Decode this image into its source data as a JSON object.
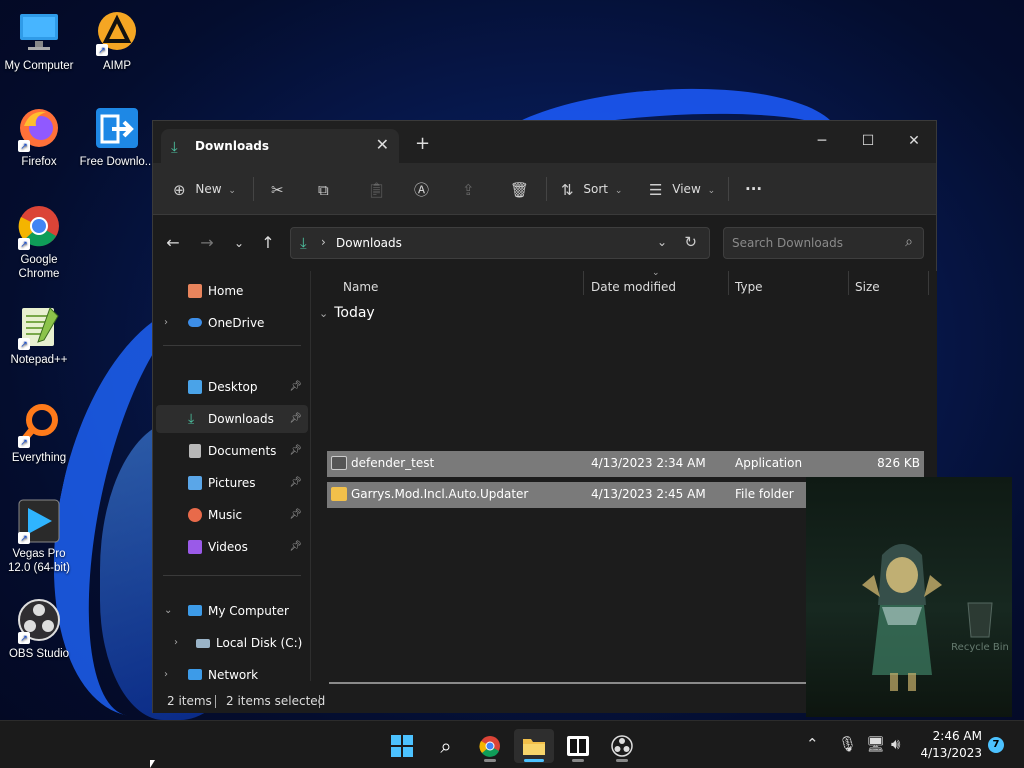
{
  "desktop": {
    "icons": [
      {
        "label": "My Computer",
        "icon": "computer-icon"
      },
      {
        "label": "AIMP",
        "icon": "aimp-icon"
      },
      {
        "label": "Firefox",
        "icon": "firefox-icon"
      },
      {
        "label": "Free Downlo...",
        "icon": "download-manager-icon"
      },
      {
        "label": "Google Chrome",
        "icon": "chrome-icon"
      },
      {
        "label": "Notepad++",
        "icon": "notepad-plus-plus-icon"
      },
      {
        "label": "Everything",
        "icon": "everything-search-icon"
      },
      {
        "label": "Vegas Pro 12.0 (64-bit)",
        "icon": "vegas-pro-icon"
      },
      {
        "label": "OBS Studio",
        "icon": "obs-studio-icon"
      }
    ]
  },
  "explorer": {
    "tab_title": "Downloads",
    "new_tab": "+",
    "window_controls": {
      "minimize": "─",
      "maximize": "☐",
      "close": "✕"
    },
    "toolbar": {
      "new_label": "New",
      "sort_label": "Sort",
      "view_label": "View",
      "more_label": "···"
    },
    "address": {
      "path": "Downloads",
      "search_placeholder": "Search Downloads"
    },
    "sidebar": {
      "items": [
        {
          "label": "Home",
          "icon": "home-icon",
          "color": "#e8845c"
        },
        {
          "label": "OneDrive",
          "icon": "onedrive-icon",
          "color": "#3d8ee8"
        },
        {
          "label": "Desktop",
          "icon": "desktop-folder-icon",
          "color": "#4aa3e8"
        },
        {
          "label": "Downloads",
          "icon": "downloads-folder-icon",
          "color": "#4cc2a0"
        },
        {
          "label": "Documents",
          "icon": "documents-folder-icon",
          "color": "#b8b8b8"
        },
        {
          "label": "Pictures",
          "icon": "pictures-folder-icon",
          "color": "#5aa6e8"
        },
        {
          "label": "Music",
          "icon": "music-folder-icon",
          "color": "#e86a4a"
        },
        {
          "label": "Videos",
          "icon": "videos-folder-icon",
          "color": "#9a5ae8"
        },
        {
          "label": "My Computer",
          "icon": "computer-icon",
          "color": "#3d9be8"
        },
        {
          "label": "Local Disk (C:)",
          "icon": "drive-icon",
          "color": "#9ab4c8"
        },
        {
          "label": "Network",
          "icon": "network-icon",
          "color": "#3d9be8"
        }
      ]
    },
    "columns": {
      "name": "Name",
      "date": "Date modified",
      "type": "Type",
      "size": "Size"
    },
    "group": "Today",
    "files": [
      {
        "name": "defender_test",
        "date": "4/13/2023 2:34 AM",
        "type": "Application",
        "size": "826 KB"
      },
      {
        "name": "Garrys.Mod.Incl.Auto.Updater",
        "date": "4/13/2023 2:45 AM",
        "type": "File folder",
        "size": ""
      }
    ],
    "status": {
      "count": "2 items",
      "selected": "2 items selected"
    }
  },
  "overlay": {
    "recycle_label": "Recycle Bin"
  },
  "taskbar": {
    "clock_time": "2:46 AM",
    "clock_date": "4/13/2023",
    "notification_count": "7"
  },
  "colors": {
    "accent": "#4cc2ff",
    "selection": "#7a7a7a",
    "folder": "#f2c04a"
  }
}
